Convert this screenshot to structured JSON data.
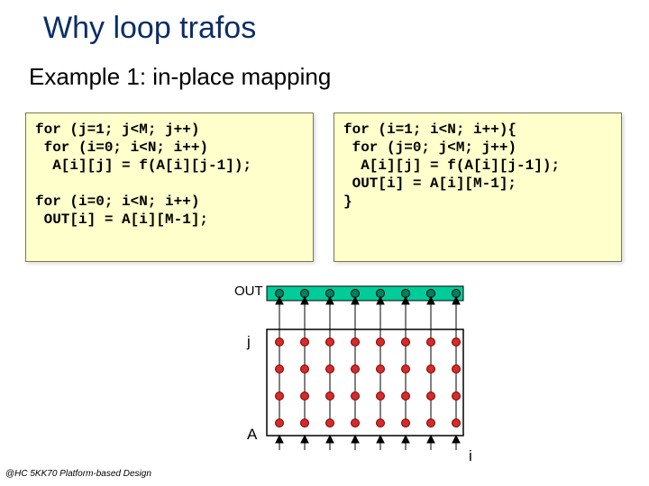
{
  "title": "Why loop trafos",
  "subtitle": "Example 1: in-place mapping",
  "code_left": "for (j=1; j<M; j++)\n for (i=0; i<N; i++)\n  A[i][j] = f(A[i][j-1]);\n\nfor (i=0; i<N; i++)\n OUT[i] = A[i][M-1];",
  "code_right": "for (i=1; i<N; i++){\n for (j=0; j<M; j++)\n  A[i][j] = f(A[i][j-1]);\n OUT[i] = A[i][M-1];\n}",
  "diagram": {
    "label_out": "OUT",
    "label_j": "j",
    "label_A": "A",
    "label_i": "i"
  },
  "footer": "@HC 5KK70 Platform-based Design",
  "chart_data": {
    "type": "diagram",
    "description": "2D iteration-space / array dependency diagram for loop transformation (in-place mapping)",
    "grid": {
      "cols": 8,
      "rows": 4,
      "x_axis": "i",
      "y_axis": "j"
    },
    "out_row": {
      "cols": 8,
      "color": "teal/green",
      "label": "OUT"
    },
    "dependencies": "vertical arrows from each A[i][j] node up to A[i][j+1] and into OUT[i]; small down-arrows entering bottom row (initial values)",
    "label_A_position": "bottom-left of grid",
    "node_color": "red with black outline"
  }
}
